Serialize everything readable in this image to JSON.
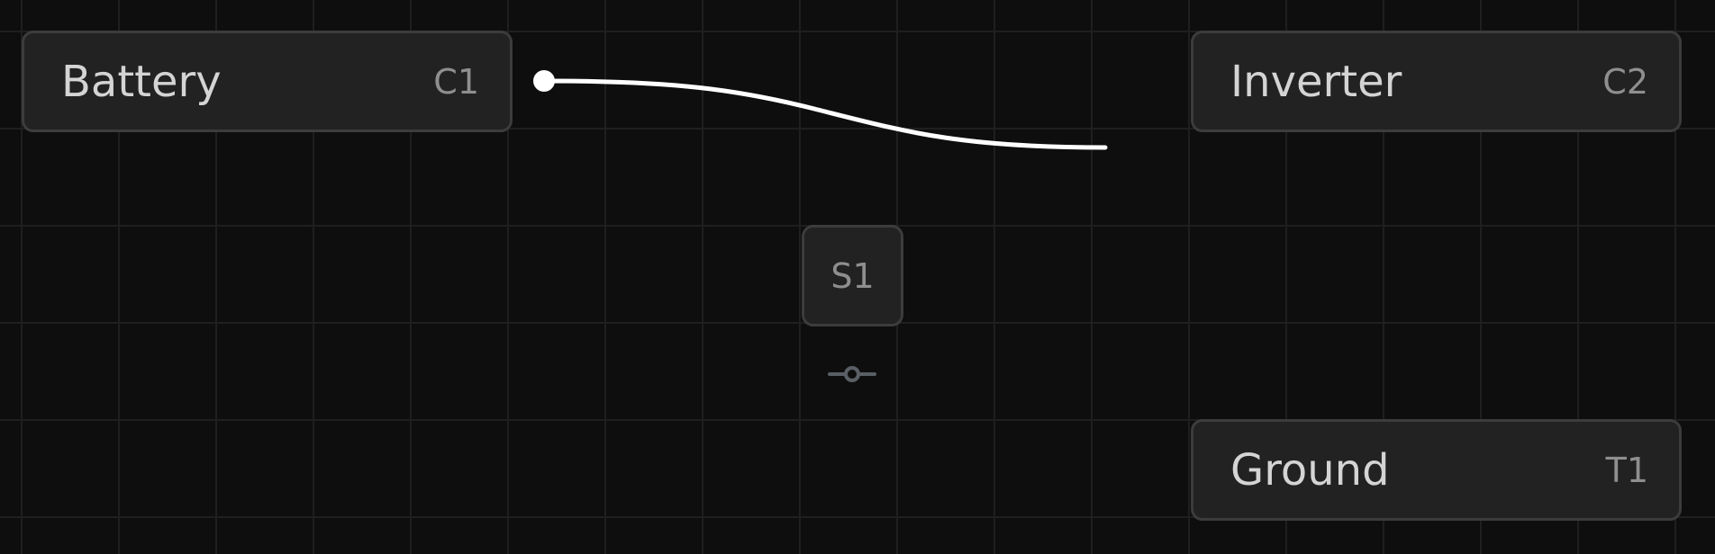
{
  "nodes": {
    "battery": {
      "label": "Battery",
      "tag": "C1"
    },
    "inverter": {
      "label": "Inverter",
      "tag": "C2"
    },
    "ground": {
      "label": "Ground",
      "tag": "T1"
    },
    "switch": {
      "tag": "S1"
    }
  },
  "wire": {
    "from": "C1",
    "color": "#ffffff"
  },
  "colors": {
    "background": "#0e0e0e",
    "grid": "#1f1f1f",
    "node_fill": "#222222",
    "node_border": "#3c3c3c",
    "label_text": "#d4d4d4",
    "tag_text": "#8f8f8f",
    "handle_icon": "#5a5f66"
  },
  "icons": {
    "switch_handle": "switch-handle-icon"
  }
}
